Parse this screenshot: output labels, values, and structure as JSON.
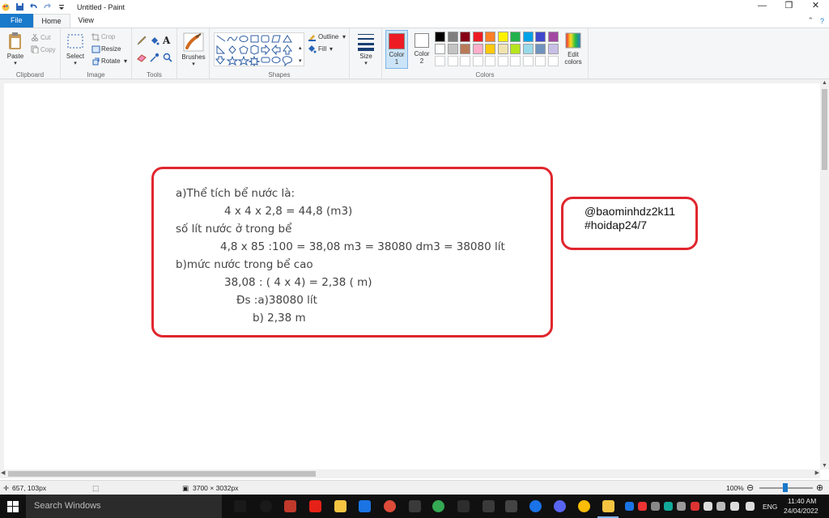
{
  "window": {
    "title": "Untitled - Paint",
    "controls": [
      "—",
      "❐",
      "✕"
    ]
  },
  "tabs": {
    "file": "File",
    "home": "Home",
    "view": "View"
  },
  "ribbon": {
    "clipboard": {
      "paste": "Paste",
      "cut": "Cut",
      "copy": "Copy",
      "group": "Clipboard"
    },
    "image": {
      "select": "Select",
      "crop": "Crop",
      "resize": "Resize",
      "rotate": "Rotate",
      "group": "Image"
    },
    "tools": {
      "group": "Tools"
    },
    "brushes": {
      "label": "Brushes"
    },
    "shapes": {
      "outline": "Outline",
      "fill": "Fill",
      "group": "Shapes"
    },
    "size": {
      "label": "Size"
    },
    "color1": {
      "label1": "Color",
      "label2": "1",
      "value": "#ed1c24"
    },
    "color2": {
      "label1": "Color",
      "label2": "2",
      "value": "#ffffff"
    },
    "colors": {
      "group": "Colors",
      "edit1": "Edit",
      "edit2": "colors"
    },
    "palette_row1": [
      "#000000",
      "#7f7f7f",
      "#880015",
      "#ed1c24",
      "#ff7f27",
      "#fff200",
      "#22b14c",
      "#00a2e8",
      "#3f48cc",
      "#a349a4"
    ],
    "palette_row2": [
      "#ffffff",
      "#c3c3c3",
      "#b97a57",
      "#ffaec9",
      "#ffc90e",
      "#efe4b0",
      "#b5e61d",
      "#99d9ea",
      "#7092be",
      "#c8bfe7"
    ]
  },
  "canvas": {
    "answer_lines": [
      "a)Thể tích bể nước là:",
      "4 x 4 x 2,8 = 44,8 (m3)",
      "số lít nước ở trong bể",
      "4,8 x 85 :100 = 38,08 m3 = 38080 dm3 = 38080 lít",
      "b)mức nước trong bể cao",
      "38,08 : ( 4 x 4) = 2,38 ( m)",
      "Đs :a)38080 lít",
      "b) 2,38 m"
    ],
    "tag_lines": [
      "@baominhdz2k11",
      "#hoidap24/7"
    ],
    "box_color": "#e0262e"
  },
  "status": {
    "cursor": "657, 103px",
    "image_size": "3700 × 3032px",
    "zoom": "100%"
  },
  "taskbar": {
    "search_placeholder": "Search Windows",
    "language": "ENG",
    "time": "11:40 AM",
    "date": "24/04/2022"
  }
}
